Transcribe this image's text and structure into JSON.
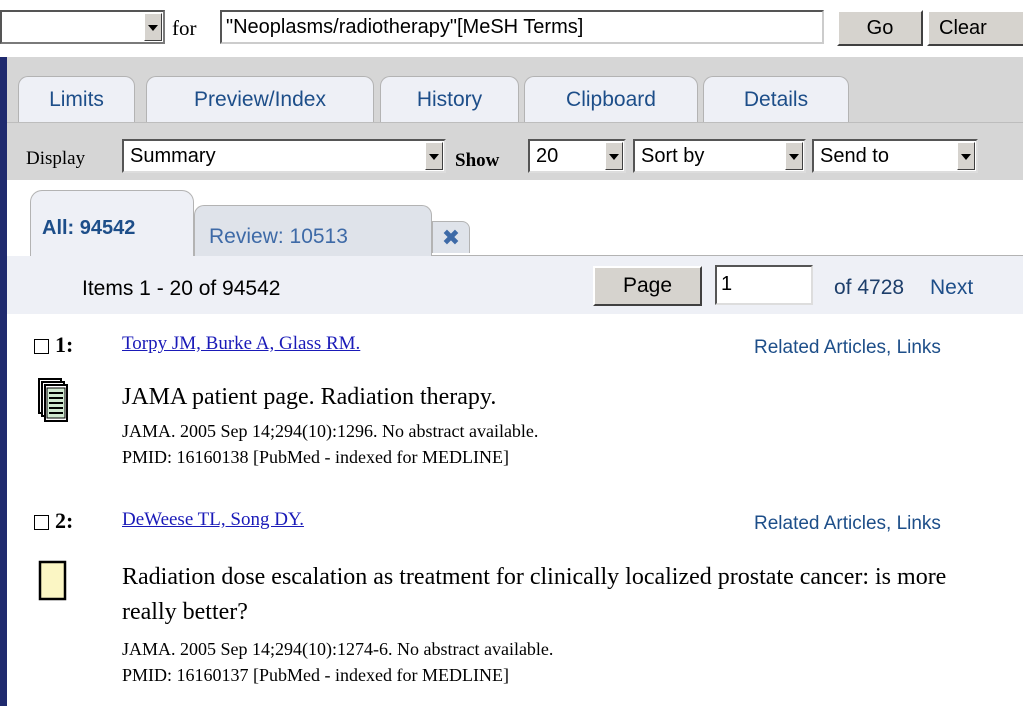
{
  "search": {
    "database_value": "",
    "for_label": "for",
    "term": "\"Neoplasms/radiotherapy\"[MeSH Terms]",
    "go_label": "Go",
    "clear_label": "Clear"
  },
  "tabs": [
    {
      "label": "Limits"
    },
    {
      "label": "Preview/Index"
    },
    {
      "label": "History"
    },
    {
      "label": "Clipboard"
    },
    {
      "label": "Details"
    }
  ],
  "toolbar": {
    "display_label": "Display",
    "display_value": "Summary",
    "show_label": "Show",
    "show_value": "20",
    "sort_value": "Sort by",
    "send_value": "Send to"
  },
  "result_tabs": {
    "all": "All: 94542",
    "review": "Review: 10513",
    "tool_icon": "tools-icon"
  },
  "pagination": {
    "items_text": "Items 1 - 20 of 94542",
    "page_button": "Page",
    "page_value": "1",
    "of_text": "of 4728",
    "next_label": "Next"
  },
  "results": [
    {
      "number": "1:",
      "authors": "Torpy JM, Burke A, Glass RM.",
      "related": "Related Articles, Links",
      "title": "JAMA patient page. Radiation therapy.",
      "citation": "JAMA. 2005 Sep 14;294(10):1296. No abstract available.",
      "pmid": "PMID: 16160138 [PubMed - indexed for MEDLINE]",
      "icon": "multi-page-document-icon"
    },
    {
      "number": "2:",
      "authors": "DeWeese TL, Song DY.",
      "related": "Related Articles, Links",
      "title": "Radiation dose escalation as treatment for clinically localized prostate cancer: is more really better?",
      "citation": "JAMA. 2005 Sep 14;294(10):1274-6. No abstract available.",
      "pmid": "PMID: 16160137 [PubMed - indexed for MEDLINE]",
      "icon": "blank-document-icon"
    }
  ]
}
